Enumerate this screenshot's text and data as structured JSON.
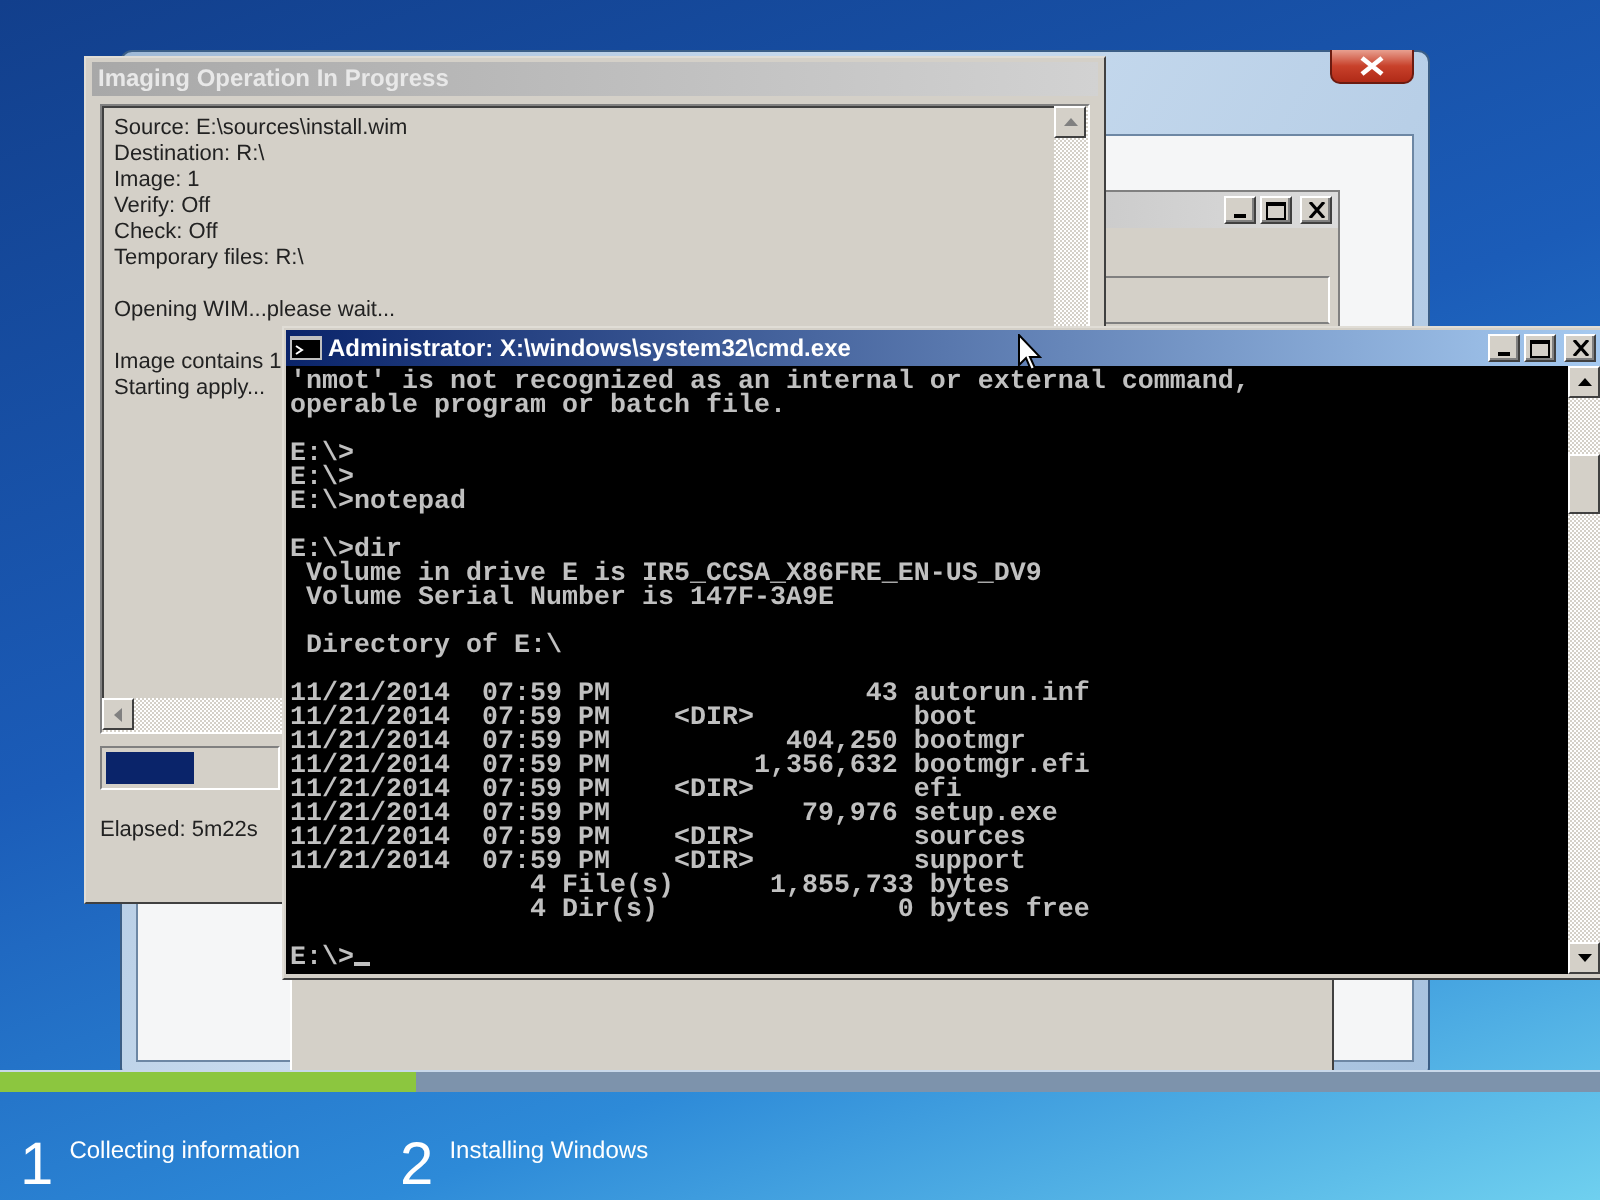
{
  "imaging_window": {
    "title": "Imaging Operation In Progress",
    "active": false,
    "blocks": [
      [
        "Source: E:\\sources\\install.wim",
        "Destination: R:\\",
        "Image: 1",
        "Verify: Off",
        "Check: Off",
        "Temporary files: R:\\"
      ],
      [
        "Opening WIM...please wait..."
      ],
      [
        "Image contains 1",
        "Starting apply..."
      ]
    ],
    "progress": {
      "level": 0.52
    },
    "elapsed": "Elapsed: 5m22s"
  },
  "cmd_window": {
    "title": "Administrator: X:\\windows\\system32\\cmd.exe",
    "active": true,
    "blocks": [
      [
        "'nmot' is not recognized as an internal or external command,",
        "operable program or batch file."
      ],
      [
        "E:\\>",
        "E:\\>",
        "E:\\>notepad"
      ],
      [
        "E:\\>dir",
        " Volume in drive E is IR5_CCSA_X86FRE_EN-US_DV9",
        " Volume Serial Number is 147F-3A9E"
      ],
      [
        " Directory of E:\\"
      ],
      [
        "11/21/2014  07:59 PM                43 autorun.inf",
        "11/21/2014  07:59 PM    <DIR>          boot",
        "11/21/2014  07:59 PM           404,250 bootmgr",
        "11/21/2014  07:59 PM         1,356,632 bootmgr.efi",
        "11/21/2014  07:59 PM    <DIR>          efi",
        "11/21/2014  07:59 PM            79,976 setup.exe",
        "11/21/2014  07:59 PM    <DIR>          sources",
        "11/21/2014  07:59 PM    <DIR>          support",
        "               4 File(s)      1,855,733 bytes",
        "               4 Dir(s)               0 bytes free"
      ],
      [
        "E:\\>"
      ]
    ]
  },
  "install_progress": {
    "level": 0.26
  },
  "steps": [
    {
      "number": "1",
      "label": "Collecting information"
    },
    {
      "number": "2",
      "label": "Installing Windows"
    }
  ]
}
